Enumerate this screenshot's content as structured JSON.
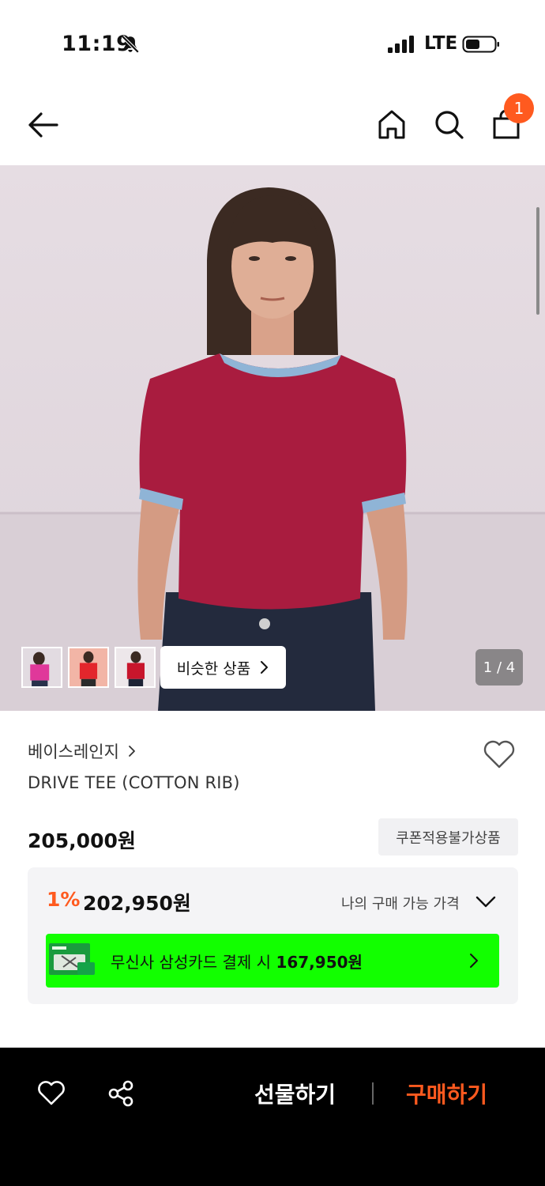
{
  "status_bar": {
    "time": "11:19",
    "network": "LTE",
    "icons": [
      "bell-off-icon",
      "signal-icon",
      "battery-icon"
    ]
  },
  "nav": {
    "icons": [
      "back-arrow-icon",
      "home-icon",
      "search-icon",
      "shopping-bag-icon"
    ],
    "cart_count": "1"
  },
  "gallery": {
    "similar_label": "비슷한 상품",
    "page_counter": "1 / 4",
    "thumbnail_count": 3
  },
  "product": {
    "brand": "베이스레인지",
    "name": "DRIVE TEE (COTTON RIB)",
    "price": "205,000원",
    "coupon_badge": "쿠폰적용불가상품"
  },
  "price_box": {
    "discount_rate": "1%",
    "discount_price": "202,950원",
    "my_price_label": "나의 구매 가능 가격",
    "card_offer_prefix": "무신사 삼성카드 결제 시",
    "card_offer_price": "167,950원"
  },
  "bottom_bar": {
    "gift_label": "선물하기",
    "buy_label": "구매하기"
  },
  "colors": {
    "accent": "#ff5a1f",
    "card_banner": "#12ff00",
    "bottom_bar": "#000000"
  }
}
